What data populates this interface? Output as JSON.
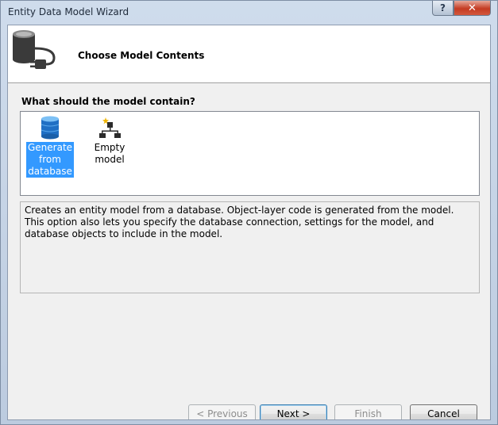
{
  "window": {
    "title": "Entity Data Model Wizard",
    "help_label": "?",
    "close_label": "✕"
  },
  "header": {
    "title": "Choose Model Contents",
    "icon": "database-plug-icon"
  },
  "contents": {
    "question": "What should the model contain?",
    "options": [
      {
        "label": "Generate from database",
        "icon": "database-icon",
        "selected": true
      },
      {
        "label": "Empty model",
        "icon": "empty-model-icon",
        "selected": false
      }
    ],
    "description": "Creates an entity model from a database. Object-layer code is generated from the model. This option also lets you specify the database connection, settings for the model, and database objects to include in the model."
  },
  "buttons": {
    "previous": "< Previous",
    "next": "Next >",
    "finish": "Finish",
    "cancel": "Cancel"
  },
  "colors": {
    "selection": "#3399ff",
    "close_button": "#c43b22"
  }
}
